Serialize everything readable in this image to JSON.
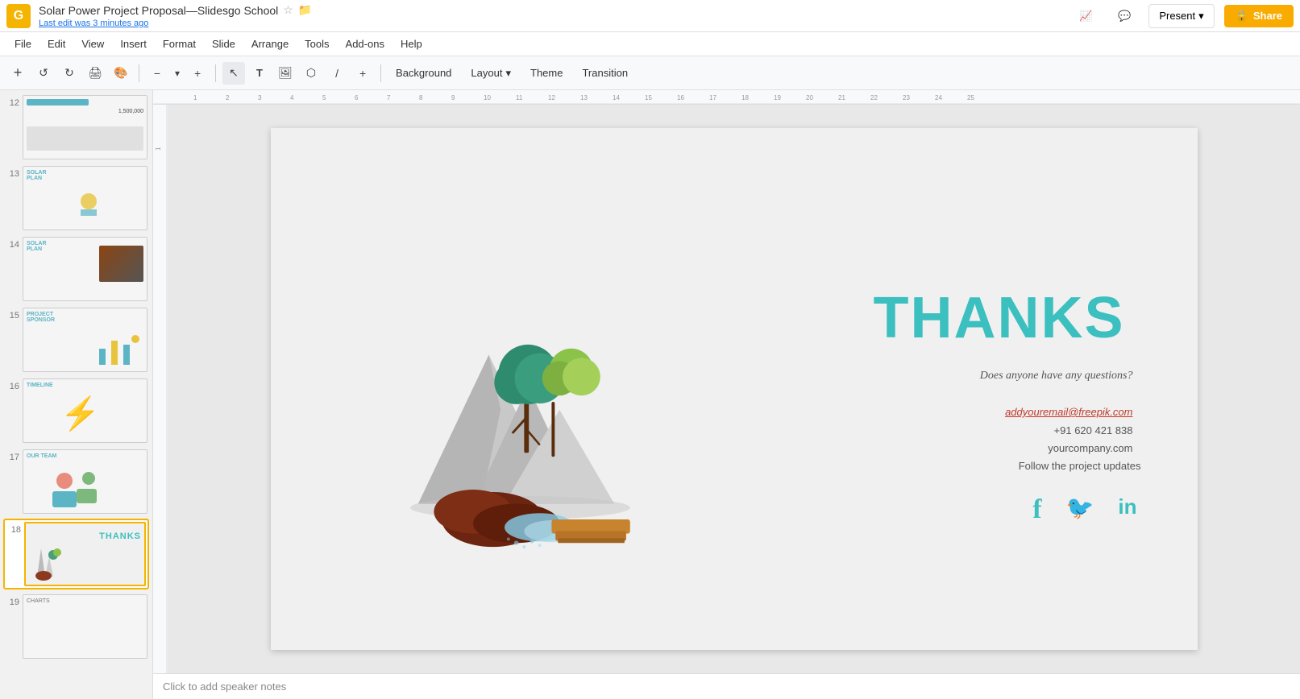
{
  "app": {
    "icon_letter": "G",
    "title": "Solar Power Project Proposal—Slidesgo School",
    "star_icon": "☆",
    "folder_icon": "📁",
    "last_edit": "Last edit was 3 minutes ago"
  },
  "top_right": {
    "trend_icon": "📈",
    "comment_icon": "💬",
    "present_label": "Present",
    "present_dropdown": "▾",
    "share_lock": "🔒",
    "share_label": "Share"
  },
  "menu": {
    "items": [
      "File",
      "Edit",
      "View",
      "Insert",
      "Format",
      "Slide",
      "Arrange",
      "Tools",
      "Add-ons",
      "Help"
    ]
  },
  "toolbar": {
    "add_btn": "+",
    "undo": "↺",
    "redo": "↻",
    "print": "🖨",
    "paint": "🎨",
    "zoom_out": "−",
    "zoom_in": "+",
    "zoom_level": "▾",
    "cursor": "↖",
    "text_box": "T",
    "image": "🖼",
    "shape": "⬡",
    "line": "/",
    "more": "+",
    "background_label": "Background",
    "layout_label": "Layout",
    "layout_arrow": "▾",
    "theme_label": "Theme",
    "transition_label": "Transition"
  },
  "slide_panel": {
    "slides": [
      {
        "num": "12",
        "active": false
      },
      {
        "num": "13",
        "active": false
      },
      {
        "num": "14",
        "active": false
      },
      {
        "num": "15",
        "active": false
      },
      {
        "num": "16",
        "active": false
      },
      {
        "num": "17",
        "active": false
      },
      {
        "num": "18",
        "active": true
      },
      {
        "num": "19",
        "active": false
      }
    ]
  },
  "slide": {
    "thanks_text": "THANKS",
    "subtitle": "Does anyone have any questions?",
    "email": "addyouremail@freepik.com",
    "phone": "+91 620 421 838",
    "website": "yourcompany.com",
    "follow": "Follow the project updates"
  },
  "notes": {
    "placeholder": "Click to add speaker notes"
  }
}
